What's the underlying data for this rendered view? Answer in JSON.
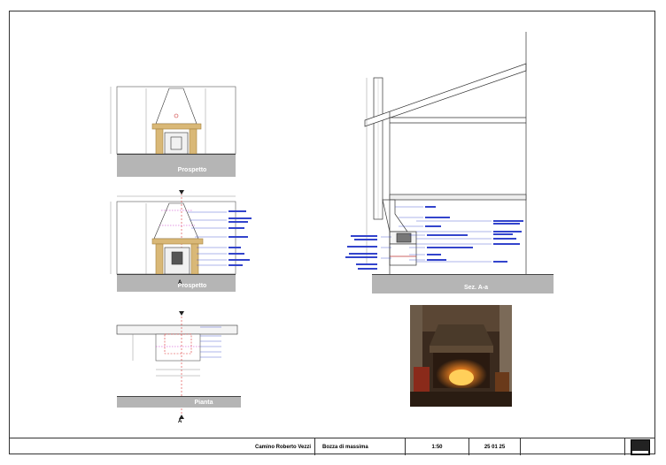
{
  "views": {
    "prospetto_top": "Prospetto",
    "prospetto_mid": "Prospetto",
    "pianta": "Pianta",
    "sezione": "Sez. A-a",
    "section_mark": "A"
  },
  "titleblock": {
    "project": "Camino Roberto Vezzi",
    "phase": "Bozza di massima",
    "scale": "1:50",
    "date": "25 01 25",
    "logo_icon": "studio-logo-icon"
  },
  "colors": {
    "annotation": "#3344cc",
    "dimension": "#333333",
    "ground": "#b5b5b5",
    "wood": "#c8a15a"
  }
}
